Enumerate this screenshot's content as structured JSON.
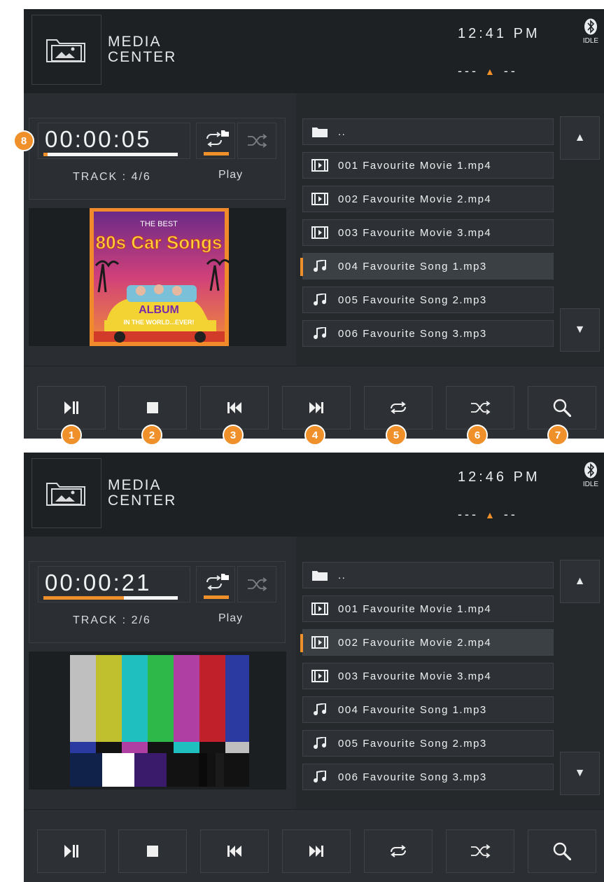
{
  "screens": [
    {
      "header": {
        "title_line1": "MEDIA",
        "title_line2": "CENTER",
        "time": "12:41 PM",
        "bt_status": "IDLE",
        "volume_left": "---",
        "volume_right": "--"
      },
      "player": {
        "elapsed": "00:00:05",
        "progress": 0.03,
        "track": "TRACK : 4/6",
        "status": "Play"
      },
      "preview": {
        "album_title_top": "THE BEST",
        "album_title_main": "80s Car Songs",
        "album_sticker": "ALBUM",
        "album_subtitle": "IN THE WORLD...EVER!"
      },
      "files": [
        {
          "name": "..",
          "type": "folder-icon"
        },
        {
          "name": "001 Favourite Movie 1.mp4",
          "type": "film-icon"
        },
        {
          "name": "002 Favourite Movie 2.mp4",
          "type": "film-icon"
        },
        {
          "name": "003 Favourite Movie 3.mp4",
          "type": "film-icon"
        },
        {
          "name": "004 Favourite Song 1.mp3",
          "type": "music-note-icon",
          "selected": true
        },
        {
          "name": "005 Favourite Song 2.mp3",
          "type": "music-note-icon"
        },
        {
          "name": "006 Favourite Song 3.mp3",
          "type": "music-note-icon"
        }
      ]
    },
    {
      "header": {
        "title_line1": "MEDIA",
        "title_line2": "CENTER",
        "time": "12:46 PM",
        "bt_status": "IDLE",
        "volume_left": "---",
        "volume_right": "--"
      },
      "player": {
        "elapsed": "00:00:21",
        "progress": 0.6,
        "track": "TRACK : 2/6",
        "status": "Play"
      },
      "preview": {
        "type": "color-bars"
      },
      "files": [
        {
          "name": "..",
          "type": "folder-icon"
        },
        {
          "name": "001 Favourite Movie 1.mp4",
          "type": "film-icon"
        },
        {
          "name": "002 Favourite Movie 2.mp4",
          "type": "film-icon",
          "selected": true
        },
        {
          "name": "003 Favourite Movie 3.mp4",
          "type": "film-icon"
        },
        {
          "name": "004 Favourite Song 1.mp3",
          "type": "music-note-icon"
        },
        {
          "name": "005 Favourite Song 2.mp3",
          "type": "music-note-icon"
        },
        {
          "name": "006 Favourite Song 3.mp3",
          "type": "music-note-icon"
        }
      ]
    }
  ],
  "controls": [
    "play-pause-icon",
    "stop-icon",
    "previous-icon",
    "next-icon",
    "repeat-icon",
    "shuffle-icon",
    "search-icon"
  ],
  "callouts": [
    "1",
    "2",
    "3",
    "4",
    "5",
    "6",
    "7",
    "8"
  ],
  "colors": {
    "accent": "#f0902a",
    "panel": "#1e2225",
    "button": "#2d3135"
  }
}
